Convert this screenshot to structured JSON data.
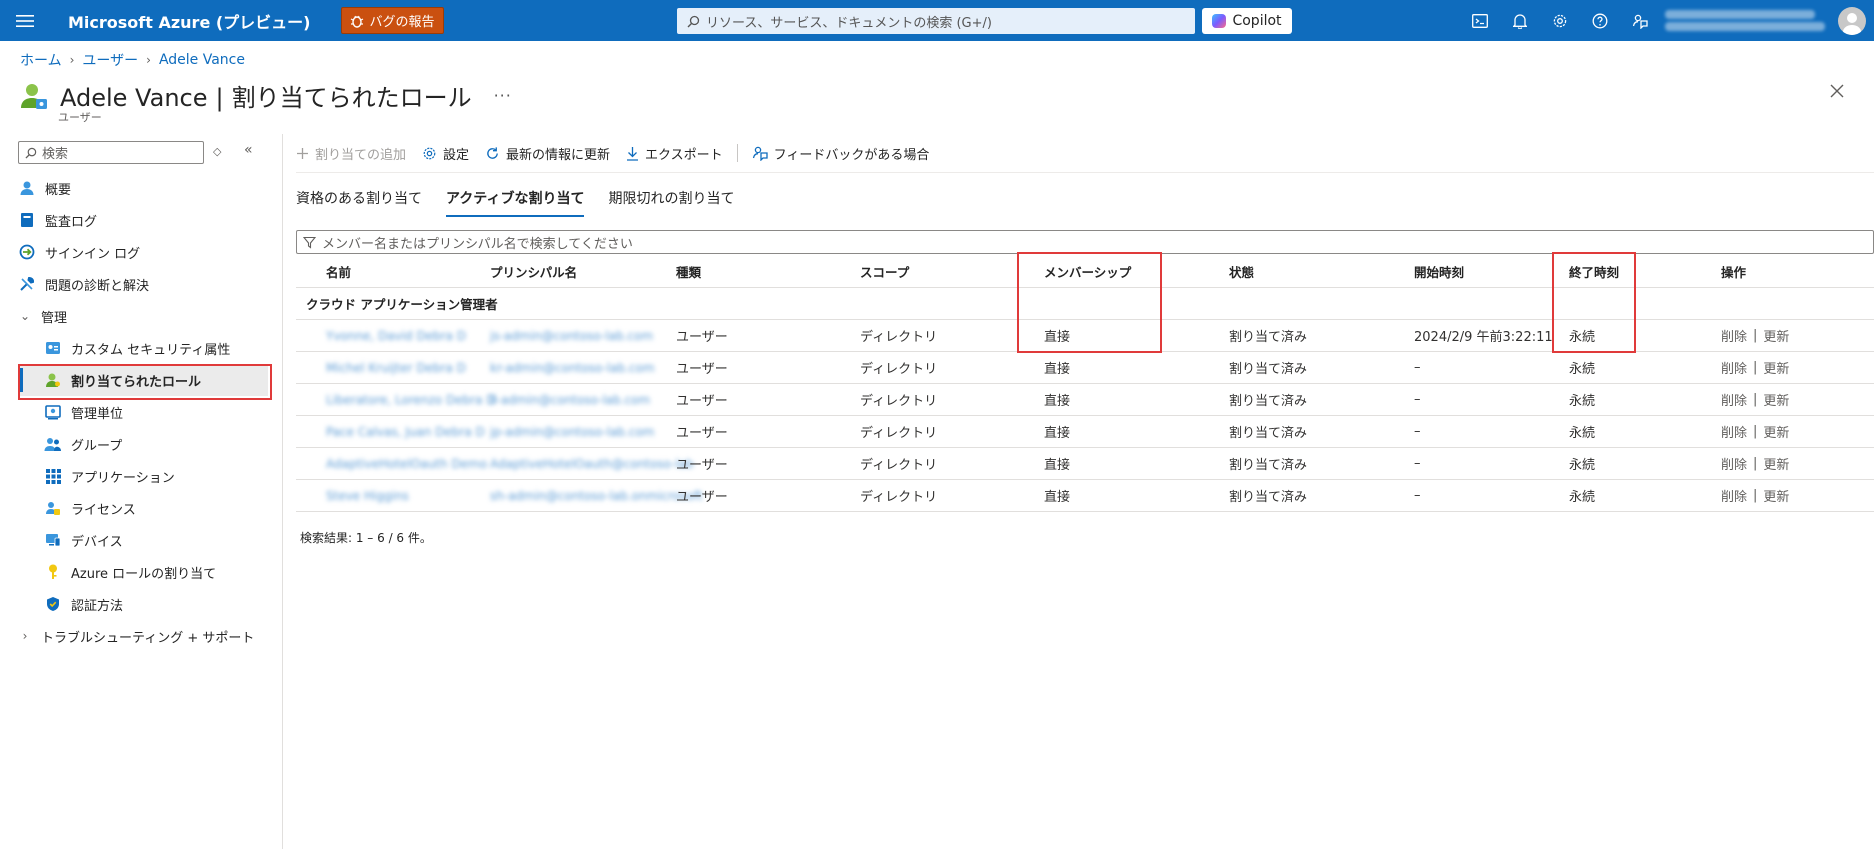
{
  "topbar": {
    "brand": "Microsoft Azure (プレビュー)",
    "bug_button": "バグの報告",
    "search_placeholder": "リソース、サービス、ドキュメントの検索 (G+/)",
    "copilot": "Copilot",
    "icons": [
      "cloud-shell-icon",
      "bell-icon",
      "gear-icon",
      "help-icon",
      "feedback-icon"
    ]
  },
  "breadcrumb": [
    "ホーム",
    "ユーザー",
    "Adele Vance"
  ],
  "page": {
    "user_name": "Adele Vance",
    "title_sep": "|",
    "title": "割り当てられたロール",
    "more": "···",
    "subtitle": "ユーザー"
  },
  "sidebar": {
    "search_placeholder": "検索",
    "items": [
      {
        "label": "概要",
        "icon": "user-icon"
      },
      {
        "label": "監査ログ",
        "icon": "book-icon"
      },
      {
        "label": "サインイン ログ",
        "icon": "signin-icon"
      },
      {
        "label": "問題の診断と解決",
        "icon": "wrench-icon"
      },
      {
        "label": "管理",
        "icon": "chevron-down-icon"
      },
      {
        "label": "カスタム セキュリティ属性",
        "icon": "security-attr-icon"
      },
      {
        "label": "割り当てられたロール",
        "icon": "role-user-icon"
      },
      {
        "label": "管理単位",
        "icon": "admin-unit-icon"
      },
      {
        "label": "グループ",
        "icon": "group-icon"
      },
      {
        "label": "アプリケーション",
        "icon": "apps-grid-icon"
      },
      {
        "label": "ライセンス",
        "icon": "license-icon"
      },
      {
        "label": "デバイス",
        "icon": "device-icon"
      },
      {
        "label": "Azure ロールの割り当て",
        "icon": "key-icon"
      },
      {
        "label": "認証方法",
        "icon": "shield-icon"
      },
      {
        "label": "トラブルシューティング + サポート",
        "icon": "chevron-right-icon"
      }
    ]
  },
  "toolbar": {
    "add": "割り当ての追加",
    "settings": "設定",
    "refresh": "最新の情報に更新",
    "export": "エクスポート",
    "feedback": "フィードバックがある場合"
  },
  "tabs": [
    "資格のある割り当て",
    "アクティブな割り当て",
    "期限切れの割り当て"
  ],
  "filter_placeholder": "メンバー名またはプリンシパル名で検索してください",
  "table": {
    "columns": [
      "名前",
      "プリンシパル名",
      "種類",
      "スコープ",
      "メンバーシップ",
      "状態",
      "開始時刻",
      "終了時刻",
      "操作"
    ],
    "group": "クラウド アプリケーション管理者",
    "rows": [
      {
        "name": "Yvonne, David Debra D",
        "principal": "js-admin@contoso-lab.com",
        "type": "ユーザー",
        "scope": "ディレクトリ",
        "membership": "直接",
        "state": "割り当て済み",
        "start": "2024/2/9 午前3:22:11",
        "end": "永続",
        "delete": "削除",
        "sep": "|",
        "update": "更新"
      },
      {
        "name": "Michel Kruijter Debra D",
        "principal": "kr-admin@contoso-lab.com",
        "type": "ユーザー",
        "scope": "ディレクトリ",
        "membership": "直接",
        "state": "割り当て済み",
        "start": "–",
        "end": "永続",
        "delete": "削除",
        "sep": "|",
        "update": "更新"
      },
      {
        "name": "Liberatore, Lorenzo Debra D",
        "principal": "ll-admin@contoso-lab.com",
        "type": "ユーザー",
        "scope": "ディレクトリ",
        "membership": "直接",
        "state": "割り当て済み",
        "start": "–",
        "end": "永続",
        "delete": "削除",
        "sep": "|",
        "update": "更新"
      },
      {
        "name": "Pace Calvas, Juan Debra D",
        "principal": "jp-admin@contoso-lab.com",
        "type": "ユーザー",
        "scope": "ディレクトリ",
        "membership": "直接",
        "state": "割り当て済み",
        "start": "–",
        "end": "永続",
        "delete": "削除",
        "sep": "|",
        "update": "更新"
      },
      {
        "name": "AdaptiveHotelOauth Demo",
        "principal": "AdaptiveHotelOauth@contoso-lab",
        "type": "ユーザー",
        "scope": "ディレクトリ",
        "membership": "直接",
        "state": "割り当て済み",
        "start": "–",
        "end": "永続",
        "delete": "削除",
        "sep": "|",
        "update": "更新"
      },
      {
        "name": "Steve Higgins",
        "principal": "sh-admin@contoso-lab.onmicrosoft",
        "type": "ユーザー",
        "scope": "ディレクトリ",
        "membership": "直接",
        "state": "割り当て済み",
        "start": "–",
        "end": "永続",
        "delete": "削除",
        "sep": "|",
        "update": "更新"
      }
    ]
  },
  "results_text": "検索結果: 1 – 6 / 6 件。",
  "colors": {
    "topbar": "#0f6cbd",
    "bug": "#ca5010",
    "highlight": "#e03a3a",
    "accent": "#0f6cbd"
  }
}
